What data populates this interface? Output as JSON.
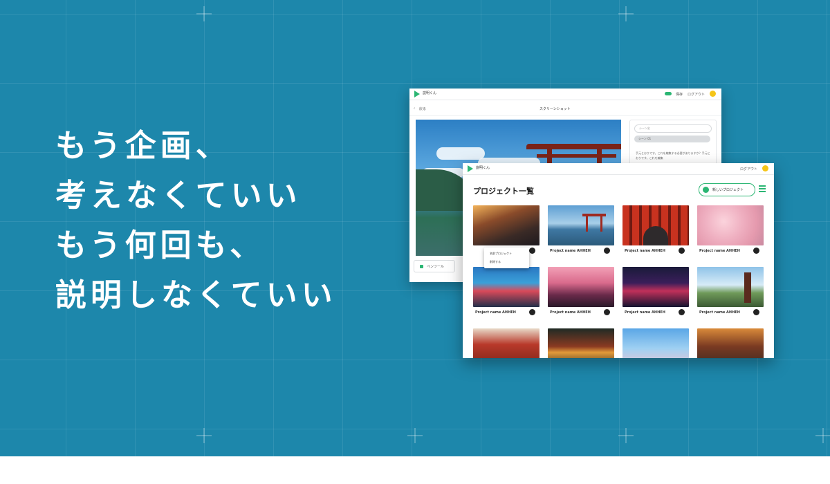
{
  "headline": {
    "lines": [
      "もう企画、",
      "考えなくていい",
      "もう何回も、",
      "説明しなくていい"
    ]
  },
  "screenshot_window": {
    "logo_text": "説明くん",
    "topbar_status": "保存",
    "topbar_user": "ログアウト",
    "back_label": "戻る",
    "title": "スクリーンショット",
    "side_input_placeholder": "シーン名",
    "side_tag": "シーン 01",
    "side_text": "手元とおりです。これを編集する必要がありますか？手元とおりです。これを編集",
    "pen_tool_label": "ペンツール"
  },
  "projects_window": {
    "logo_text": "説明くん",
    "topbar_user": "ログアウト",
    "page_title": "プロジェクト一覧",
    "new_project_button": "新しいプロジェクト",
    "context_menu": [
      "名前プロジェクト",
      "削除する"
    ],
    "cards": [
      {
        "label": "",
        "thumb": "street-night"
      },
      {
        "label": "Project name AHHEH",
        "thumb": "torii-lake"
      },
      {
        "label": "Project name AHHEH",
        "thumb": "torii-path"
      },
      {
        "label": "Project name AHHEH",
        "thumb": "sakura"
      },
      {
        "label": "Project name AHHEH",
        "thumb": "city-crossing"
      },
      {
        "label": "Project name AHHEH",
        "thumb": "sakura-river"
      },
      {
        "label": "Project name AHHEH",
        "thumb": "neon-alley"
      },
      {
        "label": "Project name AHHEH",
        "thumb": "pagoda-fuji"
      },
      {
        "label": "",
        "thumb": "torii-gate"
      },
      {
        "label": "",
        "thumb": "lantern-street"
      },
      {
        "label": "",
        "thumb": "blossom-sky"
      },
      {
        "label": "",
        "thumb": "temple-street"
      }
    ]
  },
  "colors": {
    "banner_bg": "#1d87ab",
    "accent_green": "#2bb673",
    "avatar_yellow": "#f5c518"
  }
}
